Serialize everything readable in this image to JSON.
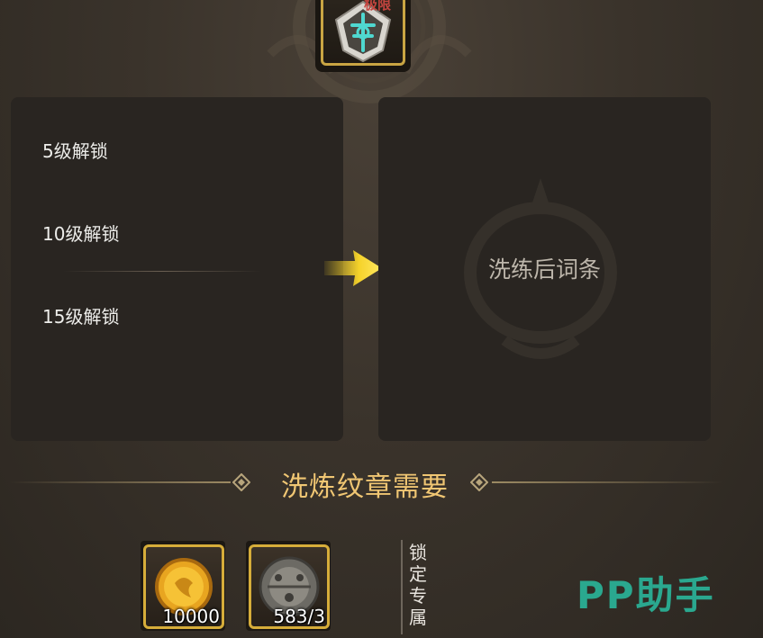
{
  "emblem": {
    "badge_text": "极限"
  },
  "left_panel": {
    "slots": [
      {
        "label": "5级解锁"
      },
      {
        "label": "10级解锁"
      },
      {
        "label": "15级解锁"
      }
    ]
  },
  "right_panel": {
    "placeholder": "洗练后词条"
  },
  "section": {
    "title": "洗炼纹章需要"
  },
  "costs": [
    {
      "icon": "gold-coin-icon",
      "count": "10000"
    },
    {
      "icon": "emblem-material-icon",
      "count": "583/3"
    }
  ],
  "lock": {
    "label": "锁定专属"
  },
  "watermark": "PP助手",
  "colors": {
    "accent_gold": "#d6ad3a",
    "title_orange": "#f0c673",
    "arrow_yellow": "#f5d22a",
    "watermark_teal": "#2aa88f"
  }
}
